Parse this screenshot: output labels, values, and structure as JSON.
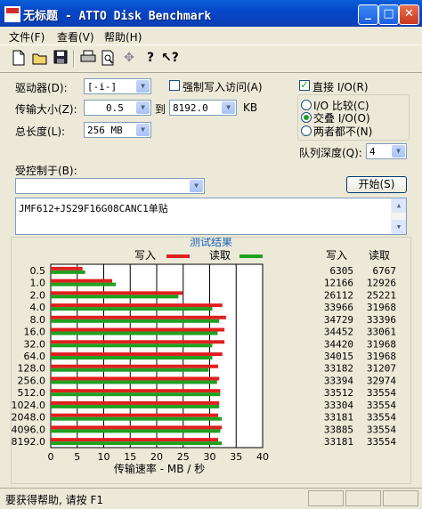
{
  "window": {
    "title": "无标题 - ATTO Disk Benchmark"
  },
  "menu": [
    "文件(F)",
    "查看(V)",
    "帮助(H)"
  ],
  "toolbar": [
    "new-doc-icon",
    "open-folder-icon",
    "save-icon",
    "print-icon",
    "print-preview-icon",
    "move-icon",
    "help-icon",
    "context-help-icon"
  ],
  "form": {
    "drive_label": "驱动器(D):",
    "drive_value": "[-i-]",
    "transfer_label": "传输大小(Z):",
    "transfer_from": "0.5",
    "to_label": "到",
    "transfer_to": "8192.0",
    "kb_label": "KB",
    "total_label": "总长度(L):",
    "total_value": "256 MB",
    "force_write_label": "强制写入访问(A)",
    "direct_io_label": "直接 I/O(R)",
    "io_compare_label": "I/O 比较(C)",
    "overlap_io_label": "交叠 I/O(O)",
    "neither_label": "两者都不(N)",
    "queue_label": "队列深度(Q):",
    "queue_value": "4",
    "controlled_label": "受控制于(B):",
    "controlled_value": "",
    "start_label": "开始(S)",
    "description": "JMF612+JS29F16G08CANC1单贴"
  },
  "results": {
    "title": "测试结果",
    "write_legend": "写入",
    "read_legend": "读取",
    "write_col": "写入",
    "read_col": "读取",
    "xlabel": "传输速率 - MB / 秒"
  },
  "chart_data": {
    "type": "bar",
    "title": "测试结果",
    "xlabel": "传输速率 - MB / 秒",
    "xlim": [
      0,
      40
    ],
    "xticks": [
      "0",
      "5",
      "10",
      "15",
      "20",
      "25",
      "30",
      "35",
      "40"
    ],
    "categories": [
      "0.5",
      "1.0",
      "2.0",
      "4.0",
      "8.0",
      "16.0",
      "32.0",
      "64.0",
      "128.0",
      "256.0",
      "512.0",
      "1024.0",
      "2048.0",
      "4096.0",
      "8192.0"
    ],
    "series": [
      {
        "name": "写入",
        "color": "#e02020",
        "values": [
          6.0,
          11.6,
          24.9,
          32.4,
          33.1,
          32.8,
          32.8,
          32.4,
          31.6,
          31.8,
          32.0,
          31.8,
          31.6,
          32.3,
          31.6
        ]
      },
      {
        "name": "读取",
        "color": "#20a020",
        "values": [
          6.5,
          12.3,
          24.1,
          30.5,
          31.8,
          31.5,
          30.5,
          30.5,
          29.8,
          31.4,
          32.0,
          31.8,
          32.3,
          32.0,
          32.3
        ]
      }
    ],
    "write_texts": [
      "6305",
      "12166",
      "26112",
      "33966",
      "34729",
      "34452",
      "34420",
      "34015",
      "33182",
      "33394",
      "33512",
      "33304",
      "33181",
      "33885",
      "33181"
    ],
    "read_texts": [
      "6767",
      "12926",
      "25221",
      "31968",
      "33396",
      "33061",
      "31968",
      "31968",
      "31207",
      "32974",
      "33554",
      "33554",
      "33554",
      "33554",
      "33554"
    ]
  },
  "status": {
    "text": "要获得帮助, 请按 F1"
  }
}
